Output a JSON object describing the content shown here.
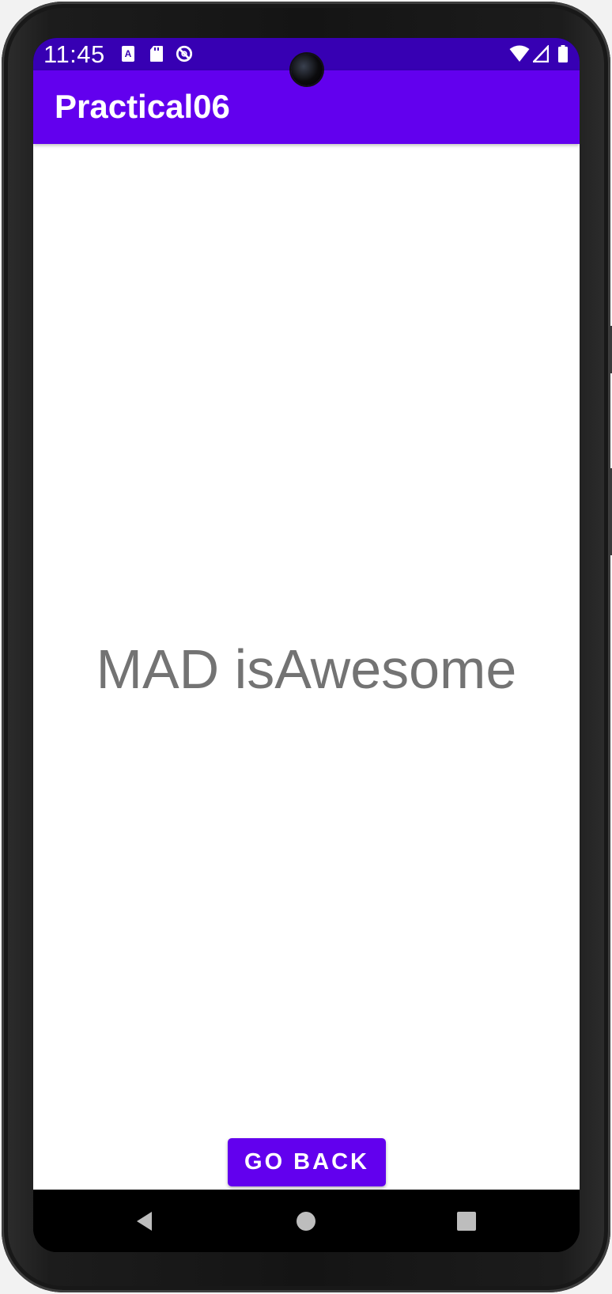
{
  "status_bar": {
    "time": "11:45",
    "left_icons": [
      "accessibility-a-icon",
      "sd-card-icon",
      "do-not-disturb-icon"
    ],
    "right_icons": [
      "wifi-icon",
      "cell-signal-icon",
      "battery-icon"
    ],
    "background": "#3700b3"
  },
  "app_bar": {
    "title": "Practical06",
    "background": "#6200ee"
  },
  "main": {
    "message": "MAD isAwesome",
    "message_color": "#737373"
  },
  "actions": {
    "go_back_label": "GO BACK",
    "accent": "#6200ee"
  },
  "nav_bar": {
    "buttons": [
      "back-triangle-icon",
      "home-circle-icon",
      "recents-square-icon"
    ]
  }
}
